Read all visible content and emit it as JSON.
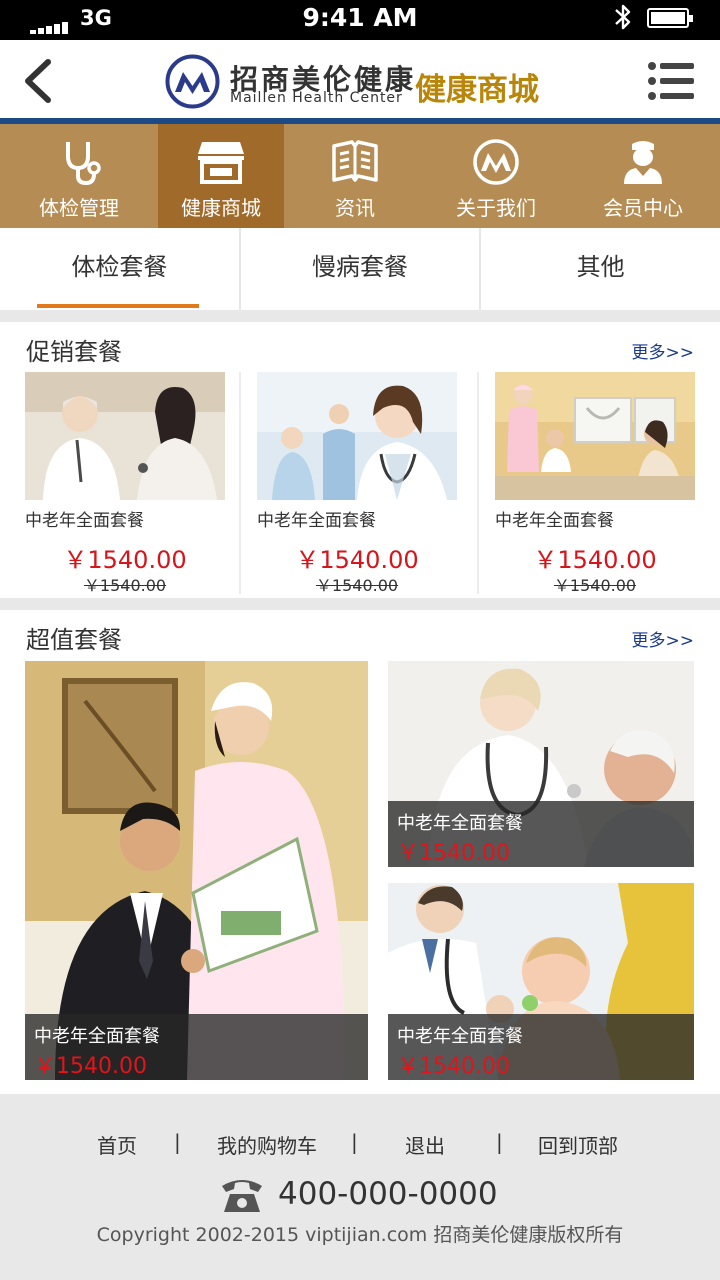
{
  "status_bar": {
    "carrier": "3G",
    "time": "9:41 AM"
  },
  "header": {
    "brand_cn": "招商美伦健康",
    "brand_en": "Maillen Health Center",
    "title": "健康商城"
  },
  "main_nav": [
    {
      "label": "体检管理",
      "icon": "stethoscope-icon",
      "active": false
    },
    {
      "label": "健康商城",
      "icon": "store-icon",
      "active": true
    },
    {
      "label": "资讯",
      "icon": "book-icon",
      "active": false
    },
    {
      "label": "关于我们",
      "icon": "brand-logo-icon",
      "active": false
    },
    {
      "label": "会员中心",
      "icon": "doctor-icon",
      "active": false
    }
  ],
  "sub_tabs": [
    {
      "label": "体检套餐",
      "active": true
    },
    {
      "label": "慢病套餐",
      "active": false
    },
    {
      "label": "其他",
      "active": false
    }
  ],
  "promo": {
    "title": "促销套餐",
    "more": "更多>>",
    "items": [
      {
        "name": "中老年全面套餐",
        "price": "￥1540.00",
        "old_price": "￥1540.00"
      },
      {
        "name": "中老年全面套餐",
        "price": "￥1540.00",
        "old_price": "￥1540.00"
      },
      {
        "name": "中老年全面套餐",
        "price": "￥1540.00",
        "old_price": "￥1540.00"
      }
    ]
  },
  "value": {
    "title": "超值套餐",
    "more": "更多>>",
    "items": [
      {
        "name": "中老年全面套餐",
        "price": "￥1540.00"
      },
      {
        "name": "中老年全面套餐",
        "price": "￥1540.00"
      },
      {
        "name": "中老年全面套餐",
        "price": "￥1540.00"
      }
    ]
  },
  "footer": {
    "links": [
      "首页",
      "我的购物车",
      "退出",
      "回到顶部"
    ],
    "separator": "|",
    "phone": "400-000-0000",
    "copyright": "Copyright 2002-2015 viptijian.com  招商美伦健康版权所有"
  },
  "colors": {
    "nav_bg": "#b58c54",
    "nav_active": "#a06a2a",
    "accent_orange": "#e07a1c",
    "price_red": "#d6141b",
    "brand_gold": "#b8860b",
    "header_rule": "#1d4a84"
  }
}
